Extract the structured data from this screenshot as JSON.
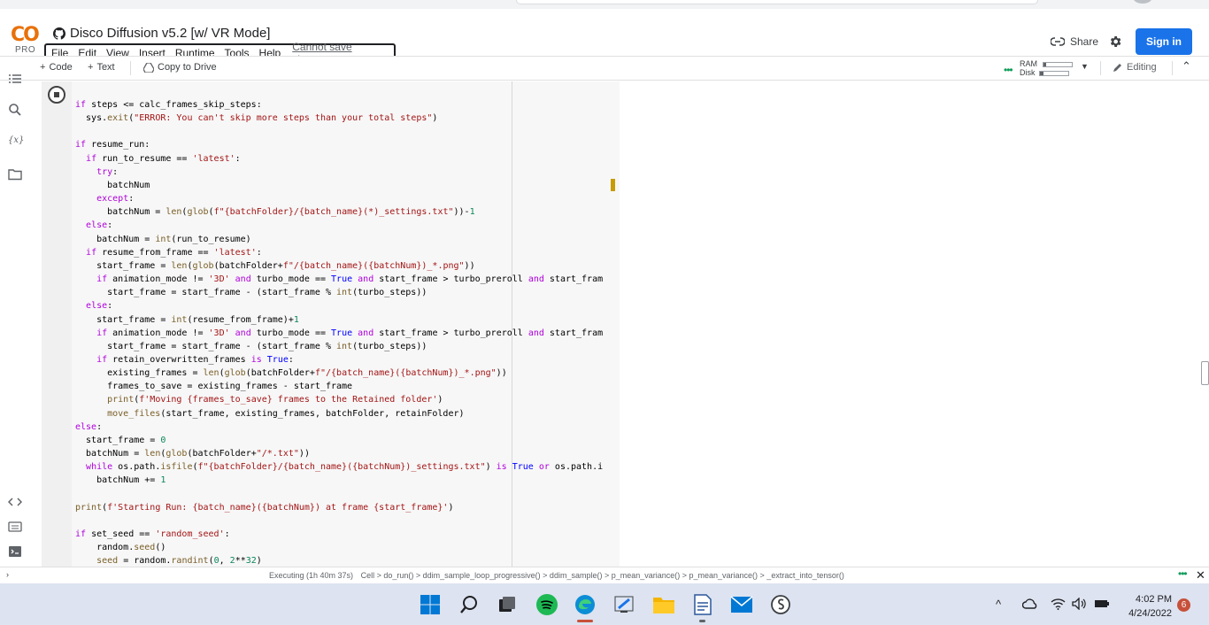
{
  "app": {
    "logo_text": "CO",
    "pro_label": "PRO",
    "title": "Disco Diffusion v5.2 [w/ VR Mode]"
  },
  "menu": {
    "items": [
      "File",
      "Edit",
      "View",
      "Insert",
      "Runtime",
      "Tools",
      "Help"
    ],
    "cannot_save": "Cannot save changes"
  },
  "header_actions": {
    "share_label": "Share",
    "sign_in_label": "Sign in"
  },
  "toolbar": {
    "code_label": "Code",
    "text_label": "Text",
    "copy_drive_label": "Copy to Drive",
    "ram_label": "RAM",
    "disk_label": "Disk",
    "ram_fraction": 0.1,
    "disk_fraction": 0.15,
    "editing_label": "Editing"
  },
  "sidebar": {
    "icons": [
      "table-of-contents-icon",
      "search-icon",
      "variables-icon",
      "files-icon"
    ],
    "variables_glyph": "{x}",
    "bottom_icons": [
      "code-snippets-icon",
      "command-palette-icon",
      "terminal-icon"
    ]
  },
  "code_lines": [
    "if steps <= calc_frames_skip_steps:",
    "  sys.exit(\"ERROR: You can't skip more steps than your total steps\")",
    "",
    "if resume_run:",
    "  if run_to_resume == 'latest':",
    "    try:",
    "      batchNum",
    "    except:",
    "      batchNum = len(glob(f\"{batchFolder}/{batch_name}(*)_settings.txt\"))-1",
    "  else:",
    "    batchNum = int(run_to_resume)",
    "  if resume_from_frame == 'latest':",
    "    start_frame = len(glob(batchFolder+f\"/{batch_name}({batchNum})_*.png\"))",
    "    if animation_mode != '3D' and turbo_mode == True and start_frame > turbo_preroll and start_fram",
    "      start_frame = start_frame - (start_frame % int(turbo_steps))",
    "  else:",
    "    start_frame = int(resume_from_frame)+1",
    "    if animation_mode != '3D' and turbo_mode == True and start_frame > turbo_preroll and start_fram",
    "      start_frame = start_frame - (start_frame % int(turbo_steps))",
    "    if retain_overwritten_frames is True:",
    "      existing_frames = len(glob(batchFolder+f\"/{batch_name}({batchNum})_*.png\"))",
    "      frames_to_save = existing_frames - start_frame",
    "      print(f'Moving {frames_to_save} frames to the Retained folder')",
    "      move_files(start_frame, existing_frames, batchFolder, retainFolder)",
    "else:",
    "  start_frame = 0",
    "  batchNum = len(glob(batchFolder+\"/*.txt\"))",
    "  while os.path.isfile(f\"{batchFolder}/{batch_name}({batchNum})_settings.txt\") is True or os.path.i",
    "    batchNum += 1",
    "",
    "print(f'Starting Run: {batch_name}({batchNum}) at frame {start_frame}')",
    "",
    "if set_seed == 'random_seed':",
    "    random.seed()",
    "    seed = random.randint(0, 2**32)"
  ],
  "status": {
    "executing": "Executing (1h 40m 37s)",
    "trace": "Cell > do_run() > ddim_sample_loop_progressive() > ddim_sample() > p_mean_variance() > p_mean_variance() > _extract_into_tensor()"
  },
  "taskbar": {
    "apps": [
      "windows-start-icon",
      "search-icon",
      "task-view-icon",
      "spotify-icon",
      "edge-icon",
      "paint-icon",
      "file-explorer-icon",
      "notepad-icon",
      "mail-icon",
      "app-icon"
    ],
    "time": "4:02 PM",
    "date": "4/24/2022",
    "notification_count": "6"
  },
  "colors": {
    "accent_blue": "#1a73e8",
    "colab_orange": "#f9ab00",
    "warning_marker": "#c89b00"
  }
}
